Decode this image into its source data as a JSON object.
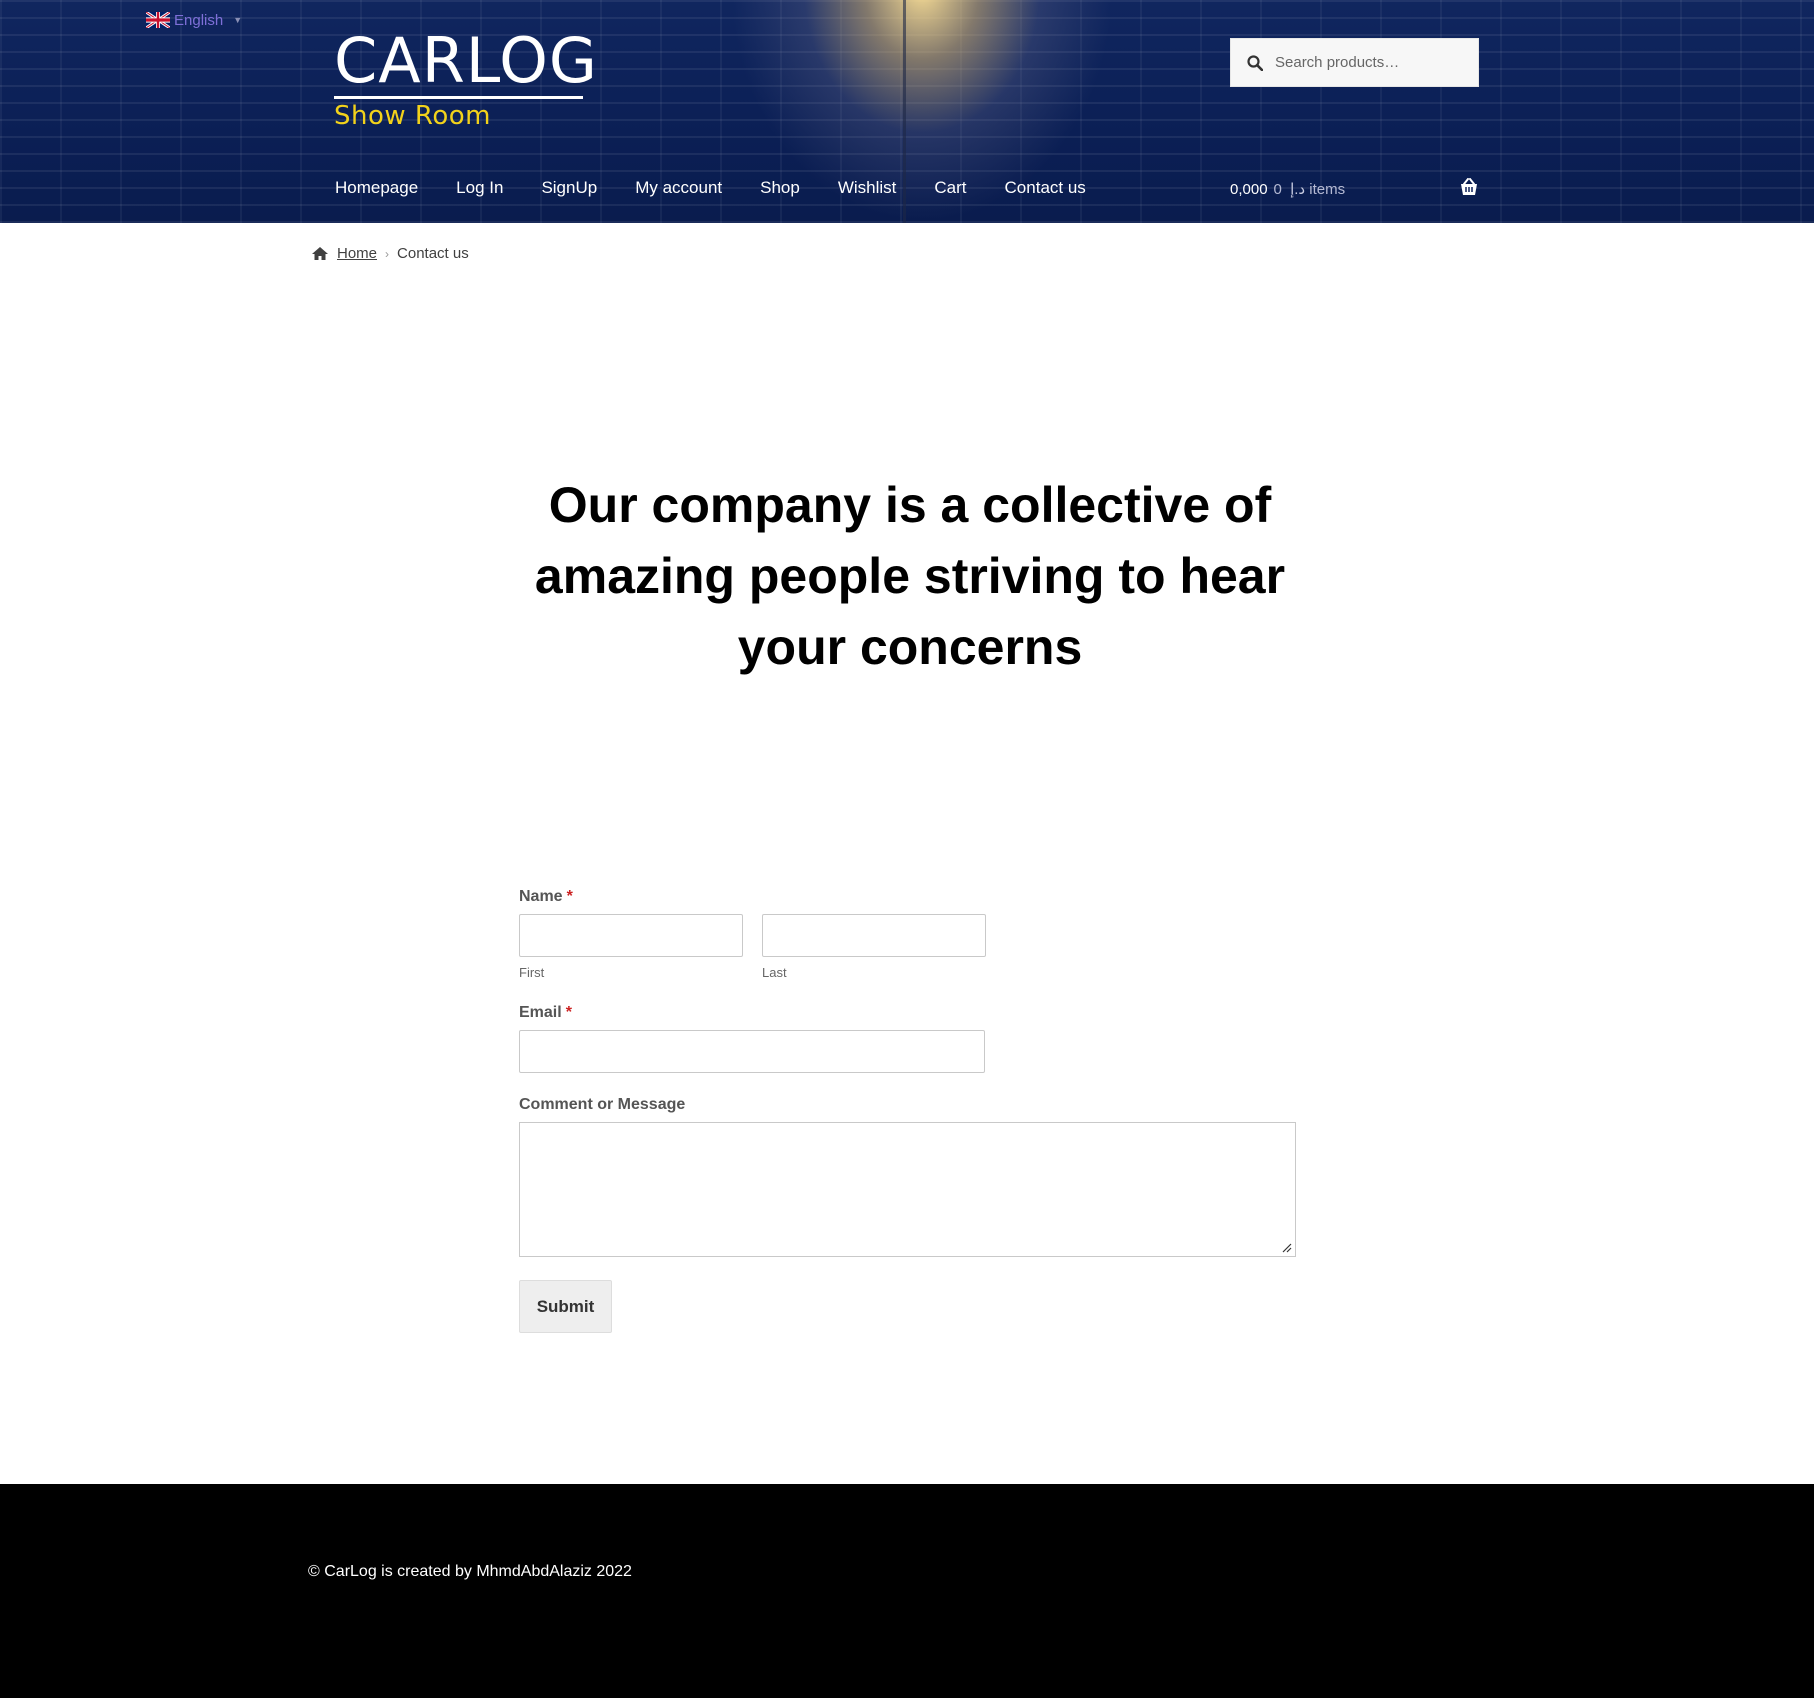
{
  "language": {
    "selected": "English",
    "flag_icon": "uk-flag-icon"
  },
  "brand": {
    "title": "CARLOG",
    "subtitle": "Show Room",
    "subtitle_color": "#f2d21b"
  },
  "search": {
    "placeholder": "Search products…"
  },
  "nav": {
    "items": [
      "Homepage",
      "Log In",
      "SignUp",
      "My account",
      "Shop",
      "Wishlist",
      "Cart",
      "Contact us"
    ]
  },
  "cart": {
    "amount": "0,000",
    "currency": "د.إ",
    "count": "0",
    "items_label": "items"
  },
  "breadcrumb": {
    "home": "Home",
    "current": "Contact us"
  },
  "headline": "Our company is a collective of amazing people striving to hear your concerns",
  "form": {
    "name_label": "Name",
    "required_mark": "*",
    "first_label": "First",
    "last_label": "Last",
    "email_label": "Email",
    "message_label": "Comment or Message",
    "submit_label": "Submit"
  },
  "footer": {
    "text": "© CarLog is created by MhmdAbdAlaziz 2022"
  },
  "colors": {
    "header_bg": "#0d2159",
    "footer_bg": "#000000",
    "required": "#cc2222"
  }
}
